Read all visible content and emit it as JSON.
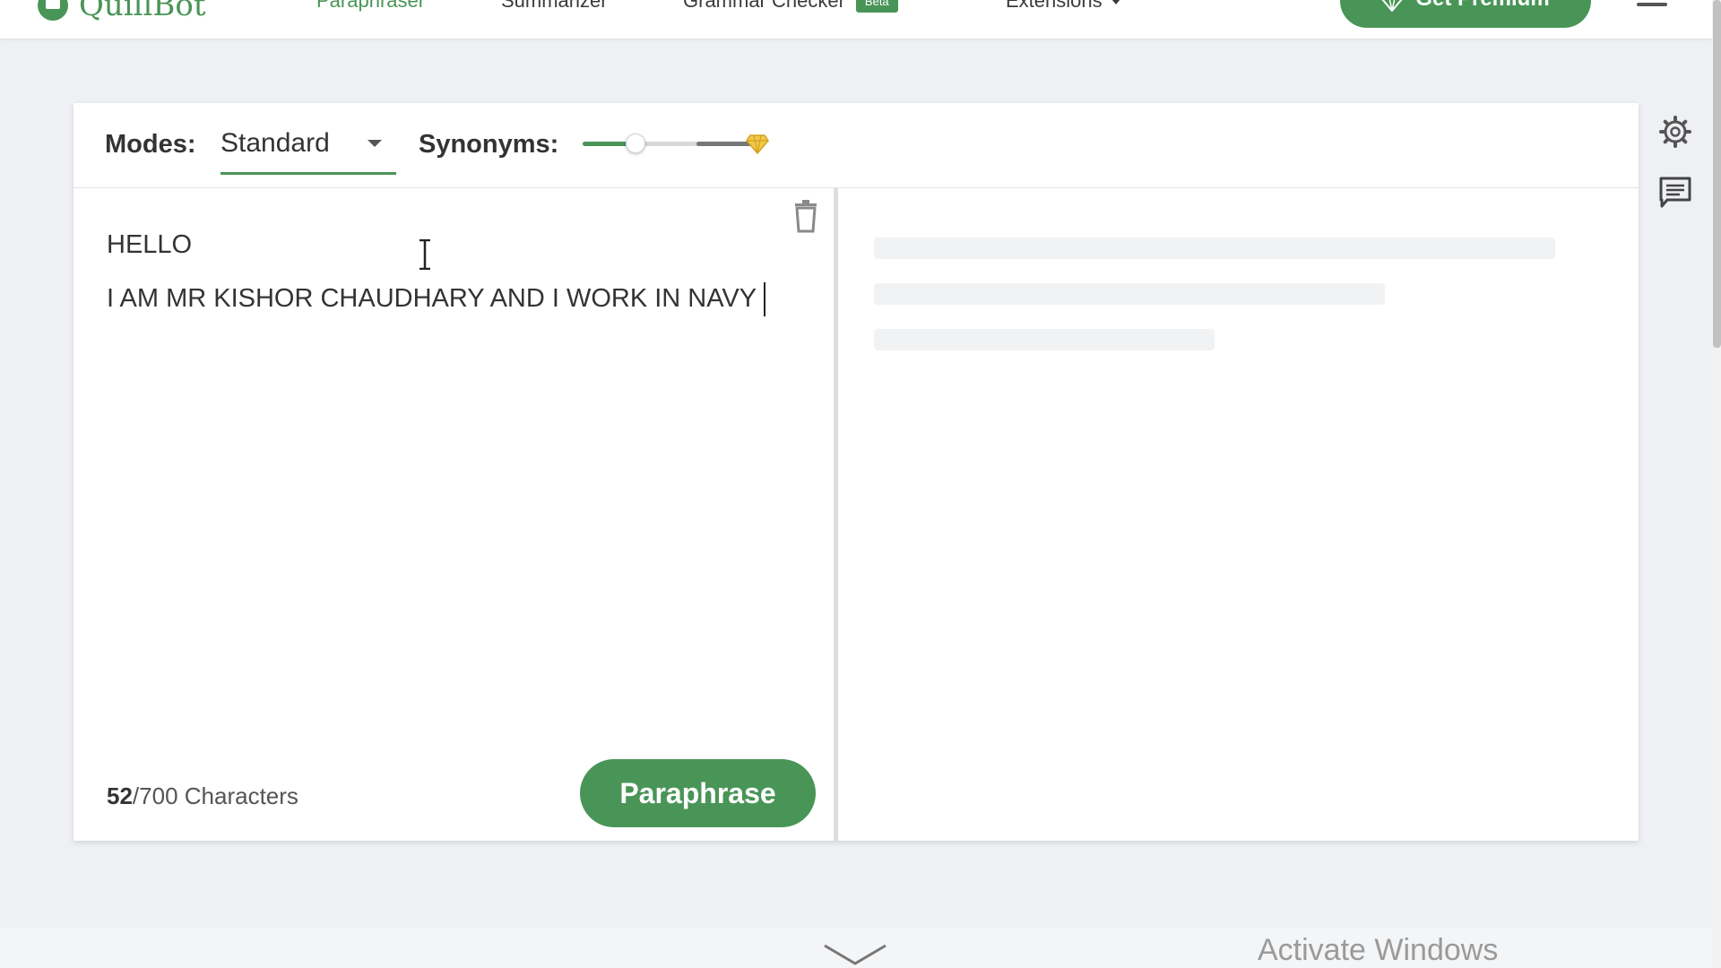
{
  "nav": {
    "logo_text": "QuillBot",
    "items": [
      {
        "label": "Paraphraser",
        "active": true
      },
      {
        "label": "Summarizer",
        "active": false
      },
      {
        "label": "Grammar Checker",
        "badge": "Beta",
        "active": false
      },
      {
        "label": "Extensions",
        "active": false
      }
    ],
    "premium_label": "Get Premium"
  },
  "toolbar": {
    "modes_label": "Modes:",
    "mode_selected": "Standard",
    "synonyms_label": "Synonyms:",
    "synonyms_level": 0.25
  },
  "input": {
    "lines": [
      "HELLO",
      "I AM MR KISHOR CHAUDHARY AND I WORK IN NAVY"
    ],
    "char_count": "52",
    "char_limit": "/700 Characters",
    "paraphrase_label": "Paraphrase"
  },
  "watermark": "Activate Windows",
  "colors": {
    "brand_green": "#499557",
    "premium_gem": "#f2c94c"
  },
  "icons": {
    "trash": "trash-icon",
    "settings": "gear-icon",
    "feedback": "comment-icon",
    "gem": "diamond-icon",
    "scroll_down": "chevron-down-icon"
  }
}
